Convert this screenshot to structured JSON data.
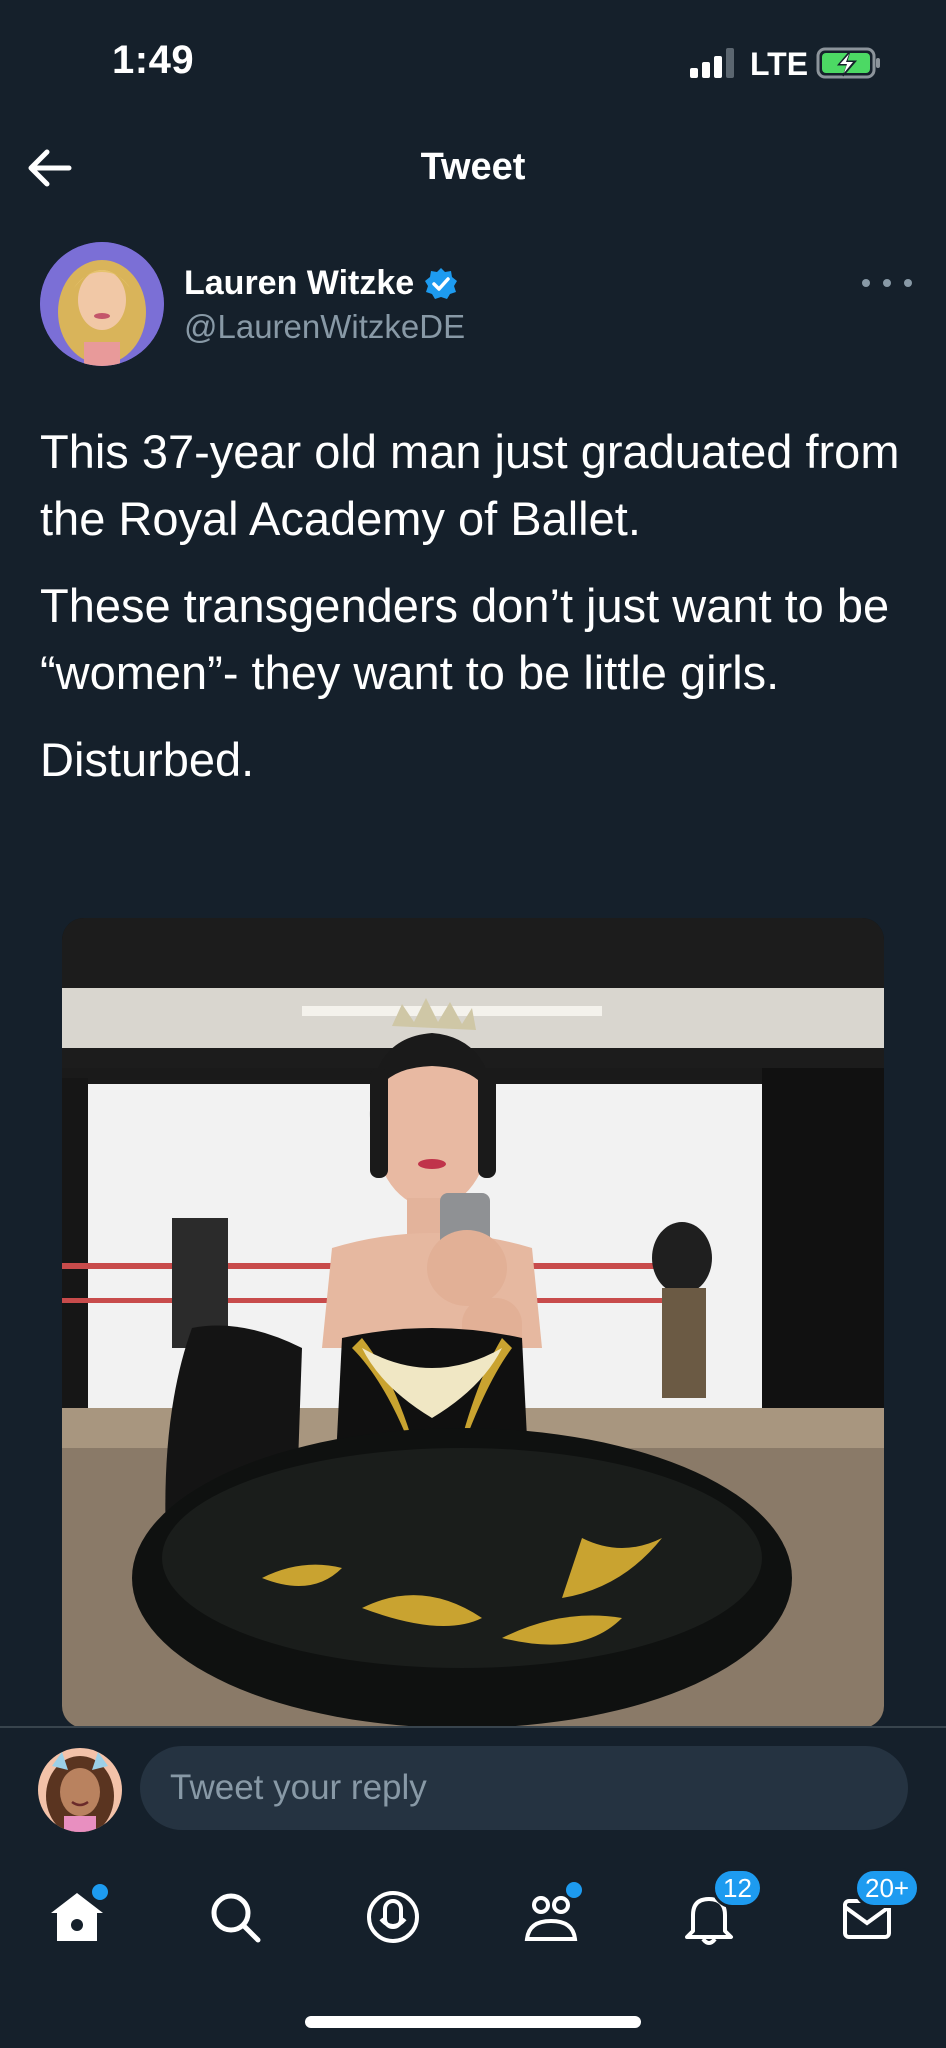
{
  "status_bar": {
    "time": "1:49",
    "network": "LTE"
  },
  "header": {
    "title": "Tweet"
  },
  "tweet": {
    "author_name": "Lauren Witzke",
    "author_handle": "@LaurenWitzkeDE",
    "paragraphs": [
      "This 37-year old man just graduated from the Royal Academy of Ballet.",
      "These transgenders don’t just want to be “women”- they want to be little girls.",
      "Disturbed."
    ]
  },
  "reply": {
    "placeholder": "Tweet your reply"
  },
  "tab_bar": {
    "items": [
      {
        "name": "home",
        "badge": ""
      },
      {
        "name": "search",
        "badge": ""
      },
      {
        "name": "spaces",
        "badge": ""
      },
      {
        "name": "communities",
        "badge": ""
      },
      {
        "name": "notifications",
        "badge": "12"
      },
      {
        "name": "messages",
        "badge": "20+"
      }
    ]
  },
  "colors": {
    "background": "#15202b",
    "accent": "#1d9bf0",
    "muted": "#8899a6",
    "battery": "#4cd964"
  }
}
